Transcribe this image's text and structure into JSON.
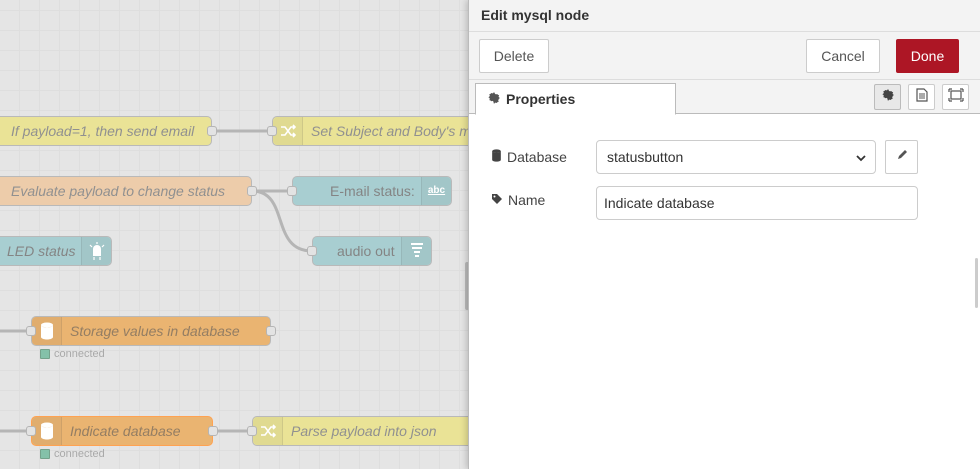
{
  "workspace": {
    "nodes": [
      {
        "name": "switch-node-if-payload",
        "label": "If payload=1, then send email",
        "kind": "switch"
      },
      {
        "name": "change-node-set-subject",
        "label": "Set Subject and Body's m",
        "kind": "change"
      },
      {
        "name": "function-node-evaluate",
        "label": "Evaluate payload to change status",
        "kind": "function"
      },
      {
        "name": "email-node",
        "label": "E-mail status:",
        "kind": "email"
      },
      {
        "name": "led-status-node",
        "label": "LED status",
        "kind": "led"
      },
      {
        "name": "audio-out-node",
        "label": "audio out",
        "kind": "audio"
      },
      {
        "name": "mysql-node-storage",
        "label": "Storage values in database",
        "kind": "mysql"
      },
      {
        "name": "mysql-node-indicate",
        "label": "Indicate database",
        "kind": "mysql"
      },
      {
        "name": "json-node-parse",
        "label": "Parse payload into json",
        "kind": "change"
      }
    ],
    "status_storage": "connected",
    "status_indicate": "connected"
  },
  "tray": {
    "title": "Edit mysql node",
    "delete_label": "Delete",
    "cancel_label": "Cancel",
    "done_label": "Done",
    "tab_properties": "Properties",
    "database_label": "Database",
    "database_value": "statusbutton",
    "name_label": "Name",
    "name_value": "Indicate database"
  },
  "colors": {
    "done_button": "#ad1625",
    "mysql_node": "#e2973b",
    "switch_node": "#e2d96e",
    "function_node": "#e7b98a",
    "teal_node": "#87bcbf"
  }
}
